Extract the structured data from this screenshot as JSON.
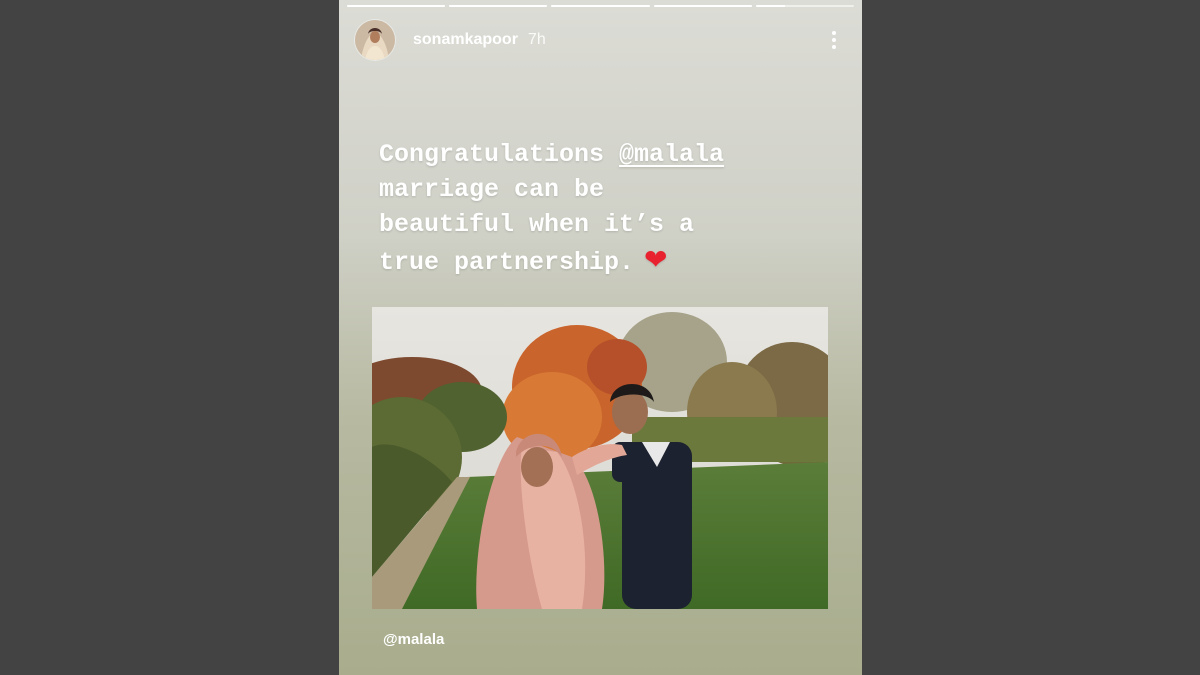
{
  "story": {
    "progress": [
      1,
      1,
      1,
      1,
      0.3
    ],
    "user": {
      "username": "sonamkapoor",
      "time": "7h",
      "avatar_icon": "profile-avatar"
    },
    "menu_icon": "more-vertical-icon",
    "caption": {
      "line1_text": "Congratulations ",
      "mention": "@malala",
      "line2": "marriage can be",
      "line3": "beautiful when it’s a",
      "line4": "true partnership.",
      "emoji": "❤"
    },
    "photo_subject": "couple in garden",
    "mention_sticker": "@malala",
    "colors": {
      "background": "#434343",
      "heart": "#e8222e",
      "text": "#ffffff"
    }
  }
}
